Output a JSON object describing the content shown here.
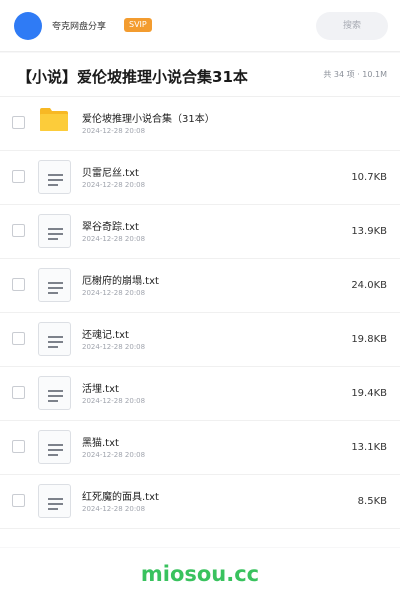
{
  "header": {
    "share_name": "夸克网盘分享",
    "badge": "SVIP",
    "search_label": "搜索"
  },
  "folder": {
    "title": "【小说】爱伦坡推理小说合集31本",
    "meta": "共 34 项 · 10.1M"
  },
  "files": [
    {
      "type": "folder",
      "icon": "folder-icon",
      "name": "爱伦坡推理小说合集（31本）",
      "date": "2024-12-28 20:08",
      "size": ""
    },
    {
      "type": "file",
      "icon": "document-icon",
      "name": "贝雷尼丝.txt",
      "date": "2024-12-28 20:08",
      "size": "10.7KB"
    },
    {
      "type": "file",
      "icon": "document-icon",
      "name": "翠谷奇踪.txt",
      "date": "2024-12-28 20:08",
      "size": "13.9KB"
    },
    {
      "type": "file",
      "icon": "document-icon",
      "name": "厄榭府的崩塌.txt",
      "date": "2024-12-28 20:08",
      "size": "24.0KB"
    },
    {
      "type": "file",
      "icon": "document-icon",
      "name": "还魂记.txt",
      "date": "2024-12-28 20:08",
      "size": "19.8KB"
    },
    {
      "type": "file",
      "icon": "document-icon",
      "name": "活埋.txt",
      "date": "2024-12-28 20:08",
      "size": "19.4KB"
    },
    {
      "type": "file",
      "icon": "document-icon",
      "name": "黑猫.txt",
      "date": "2024-12-28 20:08",
      "size": "13.1KB"
    },
    {
      "type": "file",
      "icon": "document-icon",
      "name": "红死魔的面具.txt",
      "date": "2024-12-28 20:08",
      "size": "8.5KB"
    }
  ],
  "watermark": "miosou.cc",
  "colors": {
    "avatar": "#2f7bf5",
    "badge": "#f39c2f",
    "folder": "#fbc531",
    "watermark": "#39c25e"
  }
}
